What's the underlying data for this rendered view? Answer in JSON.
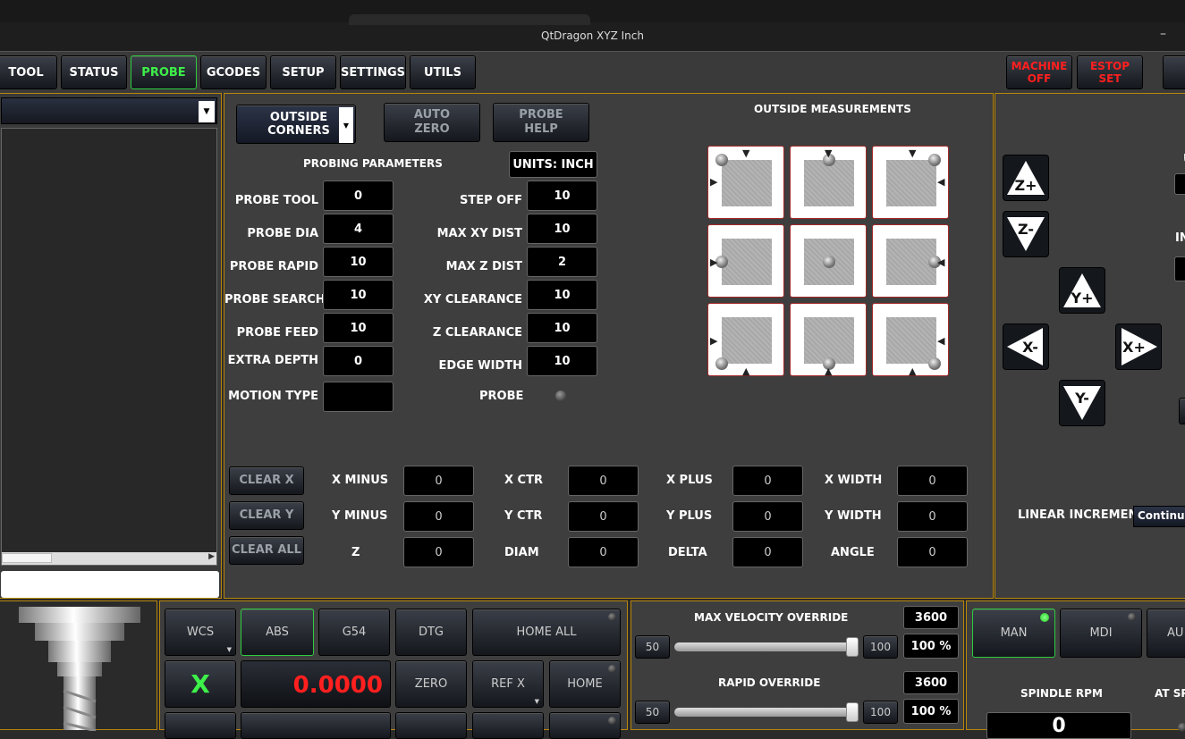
{
  "window": {
    "title": "QtDragon XYZ Inch",
    "minimize": "–"
  },
  "menu": {
    "tabs": [
      "TOOL",
      "STATUS",
      "PROBE",
      "GCODES",
      "SETUP",
      "SETTINGS",
      "UTILS"
    ],
    "machine_off": [
      "MACHINE",
      "OFF"
    ],
    "estop_set": [
      "ESTOP",
      "SET"
    ]
  },
  "probe": {
    "mode": "OUTSIDE CORNERS",
    "auto_zero": [
      "AUTO",
      "ZERO"
    ],
    "probe_help": [
      "PROBE",
      "HELP"
    ],
    "params_title": "PROBING PARAMETERS",
    "units": "UNITS: INCH",
    "left_params": [
      {
        "label": "PROBE TOOL",
        "value": "0"
      },
      {
        "label": "PROBE DIA",
        "value": "4"
      },
      {
        "label": "PROBE RAPID",
        "value": "10"
      },
      {
        "label": "PROBE SEARCH",
        "value": "10"
      },
      {
        "label": "PROBE FEED",
        "value": "10"
      },
      {
        "label": "EXTRA DEPTH",
        "value": "0"
      },
      {
        "label": "MOTION TYPE",
        "value": ""
      }
    ],
    "right_params": [
      {
        "label": "STEP OFF",
        "value": "10"
      },
      {
        "label": "MAX XY DIST",
        "value": "10"
      },
      {
        "label": "MAX Z DIST",
        "value": "2"
      },
      {
        "label": "XY CLEARANCE",
        "value": "10"
      },
      {
        "label": "Z CLEARANCE",
        "value": "10"
      },
      {
        "label": "EDGE WIDTH",
        "value": "10"
      }
    ],
    "probe_label": "PROBE",
    "measurements_title": "OUTSIDE MEASUREMENTS",
    "clear_buttons": [
      "CLEAR X",
      "CLEAR Y",
      "CLEAR ALL"
    ],
    "results": [
      [
        {
          "label": "X MINUS",
          "value": "0"
        },
        {
          "label": "X CTR",
          "value": "0"
        },
        {
          "label": "X PLUS",
          "value": "0"
        },
        {
          "label": "X WIDTH",
          "value": "0"
        }
      ],
      [
        {
          "label": "Y MINUS",
          "value": "0"
        },
        {
          "label": "Y CTR",
          "value": "0"
        },
        {
          "label": "Y PLUS",
          "value": "0"
        },
        {
          "label": "Y WIDTH",
          "value": "0"
        }
      ],
      [
        {
          "label": "Z",
          "value": "0"
        },
        {
          "label": "DIAM",
          "value": "0"
        },
        {
          "label": "DELTA",
          "value": "0"
        },
        {
          "label": "ANGLE",
          "value": "0"
        }
      ]
    ]
  },
  "jog": {
    "buttons": [
      "Z+",
      "Z-",
      "Y+",
      "X-",
      "X+",
      "Y-"
    ],
    "linear_increment_label": "LINEAR INCREMENT",
    "linear_increment_value": "Continuo",
    "partial_labels": [
      "U",
      "IN"
    ]
  },
  "dro": {
    "row1": [
      "WCS",
      "ABS",
      "G54",
      "DTG",
      "HOME ALL"
    ],
    "axis": "X",
    "value": "0.0000",
    "row2": [
      "ZERO",
      "REF X",
      "HOME"
    ]
  },
  "overrides": {
    "max_velocity": {
      "label": "MAX VELOCITY OVERRIDE",
      "value": "3600",
      "min": "50",
      "max": "100",
      "percent": "100 %",
      "level": 1.0
    },
    "rapid": {
      "label": "RAPID OVERRIDE",
      "value": "3600",
      "min": "50",
      "max": "100",
      "percent": "100 %",
      "level": 1.0
    }
  },
  "modes": {
    "buttons": [
      "MAN",
      "MDI",
      "AU"
    ],
    "spindle_rpm": "SPINDLE RPM",
    "at_speed": "AT SP",
    "rpm_value": "0"
  },
  "colors": {
    "accent": "#b8860b",
    "active": "#3ef04a",
    "alarm": "#ff1f1f"
  }
}
